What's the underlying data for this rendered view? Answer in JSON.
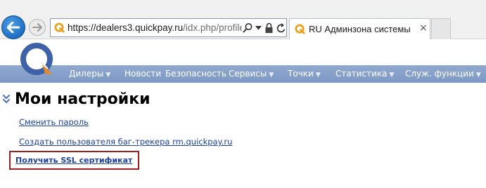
{
  "browser": {
    "address": {
      "url_main": "https://dealers3.quickpay.ru",
      "url_path": "/idx.php/profile/s"
    },
    "tab": {
      "title": "RU Админзона системы «...",
      "close_glyph": "×"
    },
    "icons": [
      "back-arrow-icon",
      "forward-arrow-icon",
      "search-icon",
      "dropdown-icon",
      "lock-icon",
      "refresh-icon",
      "close-icon"
    ]
  },
  "site": {
    "nav": {
      "items": [
        {
          "label": "Дилеры",
          "has_dropdown": true,
          "caret": "▼"
        },
        {
          "label": "Новости",
          "has_dropdown": false,
          "caret": ""
        },
        {
          "label": "Безопасность",
          "has_dropdown": false,
          "caret": ""
        },
        {
          "label": "Сервисы",
          "has_dropdown": true,
          "caret": "▼"
        },
        {
          "label": "Точки",
          "has_dropdown": true,
          "caret": "▼"
        },
        {
          "label": "Статистика",
          "has_dropdown": true,
          "caret": "▼"
        },
        {
          "label": "Служ. функции",
          "has_dropdown": true,
          "caret": "▼"
        }
      ]
    },
    "colors": {
      "nav_bg": "#839dc9",
      "link": "#1b3f9a",
      "highlight_border": "#a11f1f",
      "logo_blue": "#3e62a8",
      "logo_orange": "#e28a2b"
    }
  },
  "main": {
    "title": "Мои настройки",
    "links": [
      {
        "label": "Сменить пароль",
        "bold": false
      },
      {
        "label": "Создать пользователя баг-трекера rm.quickpay.ru",
        "bold": false
      },
      {
        "label": "Получить SSL сертификат",
        "bold": true,
        "highlighted": true
      }
    ]
  }
}
